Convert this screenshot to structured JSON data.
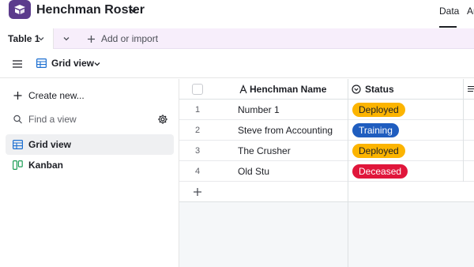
{
  "header": {
    "title": "Henchman Roster",
    "tab_data": "Data",
    "tab_automations": "Au"
  },
  "tabbar": {
    "table_tab": "Table 1",
    "add_or_import": "Add or import"
  },
  "viewbar": {
    "view_name": "Grid view"
  },
  "sidebar": {
    "create_new": "Create new...",
    "find_placeholder": "Find a view",
    "views": [
      {
        "label": "Grid view",
        "icon": "grid-icon",
        "active": true
      },
      {
        "label": "Kanban",
        "icon": "kanban-icon",
        "active": false
      }
    ]
  },
  "grid": {
    "columns": [
      {
        "label": "Henchman Name",
        "icon": "text-field-icon"
      },
      {
        "label": "Status",
        "icon": "single-select-icon"
      }
    ],
    "rows": [
      {
        "num": "1",
        "name": "Number 1",
        "status": "Deployed"
      },
      {
        "num": "2",
        "name": "Steve from Accounting",
        "status": "Training"
      },
      {
        "num": "3",
        "name": "The Crusher",
        "status": "Deployed"
      },
      {
        "num": "4",
        "name": "Old Stu",
        "status": "Deceased"
      }
    ]
  },
  "colors": {
    "brand": "#5b3b8c",
    "deployed_bg": "#fcb400",
    "deployed_fg": "#1d1f25",
    "training_bg": "#1f5dbf",
    "training_fg": "#ffffff",
    "deceased_bg": "#e0163b",
    "deceased_fg": "#ffffff"
  }
}
